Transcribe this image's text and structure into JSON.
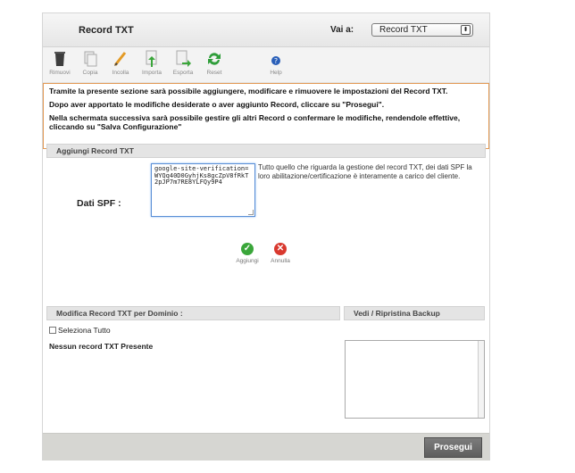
{
  "header": {
    "title": "Record TXT",
    "goto_label": "Vai a:",
    "goto_selected": "Record TXT",
    "select_arrows": "⬍"
  },
  "toolbar": [
    {
      "label": "Rimuovi",
      "icon": "trash-icon"
    },
    {
      "label": "Copia",
      "icon": "copy-icon"
    },
    {
      "label": "Incolla",
      "icon": "paste-icon"
    },
    {
      "label": "Importa",
      "icon": "import-icon"
    },
    {
      "label": "Esporta",
      "icon": "export-icon"
    },
    {
      "label": "Reset",
      "icon": "reset-icon"
    },
    {
      "label": "Help",
      "icon": "help-icon"
    }
  ],
  "info": {
    "line1": "Tramite la presente sezione sarà possibile aggiungere, modificare e rimuovere le impostazioni del Record TXT.",
    "line2": "Dopo aver apportato le modifiche desiderate o aver aggiunto Record, cliccare su \"Prosegui\".",
    "line3": "Nella schermata successiva sarà possibile gestire gli altri Record o confermare le modifiche, rendendole effettive, cliccando su \"Salva Configurazione\""
  },
  "add_section": {
    "title": "Aggiungi Record TXT",
    "spf_label": "Dati SPF :",
    "spf_value": "google-site-verification=WYQq40D0GyhjKs8gcZpV8fRkT2pJP7m7RE8YLFQy9P4",
    "help_text": "Tutto quello che riguarda la gestione del record TXT, dei dati SPF la loro abilitazione/certificazione è interamente a carico del cliente.",
    "add_label": "Aggiungi",
    "cancel_label": "Annulla"
  },
  "modify_section": {
    "title": "Modifica Record TXT per Dominio :",
    "select_all": "Seleziona Tutto",
    "empty_message": "Nessun record TXT Presente"
  },
  "backup_section": {
    "title": "Vedi / Ripristina Backup"
  },
  "footer": {
    "next_label": "Prosegui"
  },
  "colors": {
    "accent_border": "#e39a55",
    "ok_green": "#3aa63a",
    "cancel_red": "#d9392f"
  }
}
